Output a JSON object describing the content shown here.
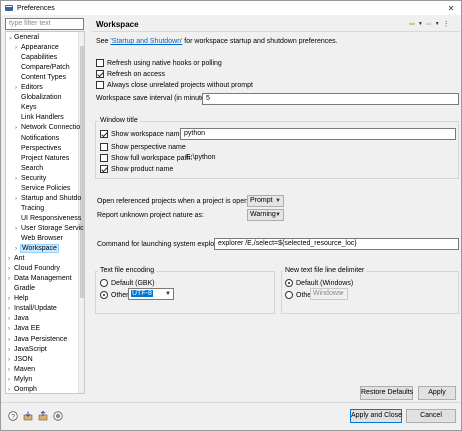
{
  "window": {
    "title": "Preferences"
  },
  "filter": {
    "placeholder": "type filter text"
  },
  "tree": [
    {
      "label": "General",
      "expanded": true,
      "indent": 0
    },
    {
      "label": "Appearance",
      "twisty": ">",
      "indent": 1
    },
    {
      "label": "Capabilities",
      "indent": 1
    },
    {
      "label": "Compare/Patch",
      "indent": 1
    },
    {
      "label": "Content Types",
      "indent": 1
    },
    {
      "label": "Editors",
      "twisty": ">",
      "indent": 1
    },
    {
      "label": "Globalization",
      "indent": 1
    },
    {
      "label": "Keys",
      "indent": 1
    },
    {
      "label": "Link Handlers",
      "indent": 1
    },
    {
      "label": "Network Connectio",
      "twisty": ">",
      "indent": 1
    },
    {
      "label": "Notifications",
      "indent": 1
    },
    {
      "label": "Perspectives",
      "indent": 1
    },
    {
      "label": "Project Natures",
      "indent": 1
    },
    {
      "label": "Search",
      "indent": 1
    },
    {
      "label": "Security",
      "twisty": ">",
      "indent": 1
    },
    {
      "label": "Service Policies",
      "indent": 1
    },
    {
      "label": "Startup and Shutdo",
      "twisty": ">",
      "indent": 1
    },
    {
      "label": "Tracing",
      "indent": 1
    },
    {
      "label": "UI Responsiveness",
      "indent": 1
    },
    {
      "label": "User Storage Servic",
      "twisty": ">",
      "indent": 1
    },
    {
      "label": "Web Browser",
      "indent": 1
    },
    {
      "label": "Workspace",
      "twisty": ">",
      "indent": 1,
      "selected": true
    },
    {
      "label": "Ant",
      "twisty": ">",
      "indent": 0
    },
    {
      "label": "Cloud Foundry",
      "twisty": ">",
      "indent": 0
    },
    {
      "label": "Data Management",
      "twisty": ">",
      "indent": 0
    },
    {
      "label": "Gradle",
      "indent": 0
    },
    {
      "label": "Help",
      "twisty": ">",
      "indent": 0
    },
    {
      "label": "Install/Update",
      "twisty": ">",
      "indent": 0
    },
    {
      "label": "Java",
      "twisty": ">",
      "indent": 0
    },
    {
      "label": "Java EE",
      "twisty": ">",
      "indent": 0
    },
    {
      "label": "Java Persistence",
      "twisty": ">",
      "indent": 0
    },
    {
      "label": "JavaScript",
      "twisty": ">",
      "indent": 0
    },
    {
      "label": "JSON",
      "twisty": ">",
      "indent": 0
    },
    {
      "label": "Maven",
      "twisty": ">",
      "indent": 0
    },
    {
      "label": "Mylyn",
      "twisty": ">",
      "indent": 0
    },
    {
      "label": "Oomph",
      "twisty": ">",
      "indent": 0
    }
  ],
  "page": {
    "title": "Workspace",
    "desc_prefix": "See ",
    "desc_link": "'Startup and Shutdown'",
    "desc_suffix": " for workspace startup and shutdown preferences.",
    "opt_refresh_native": "Refresh using native hooks or polling",
    "opt_refresh_access": "Refresh on access",
    "opt_close_unrelated": "Always close unrelated projects without prompt",
    "save_interval_label": "Workspace save interval (in minutes):",
    "save_interval_value": "5",
    "window_title_group": "Window title",
    "show_workspace_name": "Show workspace name:",
    "workspace_name_value": "python",
    "show_perspective_name": "Show perspective name",
    "show_full_path": "Show full workspace path:",
    "full_path_value": "E:\\python",
    "show_product_name": "Show product name",
    "open_referenced_label": "Open referenced projects when a project is opened:",
    "open_referenced_value": "Prompt",
    "report_unknown_label": "Report unknown project nature as:",
    "report_unknown_value": "Warning",
    "launch_cmd_label": "Command for launching system explorer:",
    "launch_cmd_value": "explorer /E,/select=${selected_resource_loc}",
    "encoding_group": "Text file encoding",
    "encoding_default": "Default (GBK)",
    "encoding_other": "Other:",
    "encoding_other_value": "UTF-8",
    "delimiter_group": "New text file line delimiter",
    "delimiter_default": "Default (Windows)",
    "delimiter_other": "Other:",
    "delimiter_other_value": "Windows",
    "restore_defaults": "Restore Defaults",
    "apply": "Apply"
  },
  "footer": {
    "apply_close": "Apply and Close",
    "cancel": "Cancel"
  },
  "colors": {
    "selection": "#0078d7",
    "link": "#0066cc",
    "tree_selected": "#cce8ff"
  }
}
